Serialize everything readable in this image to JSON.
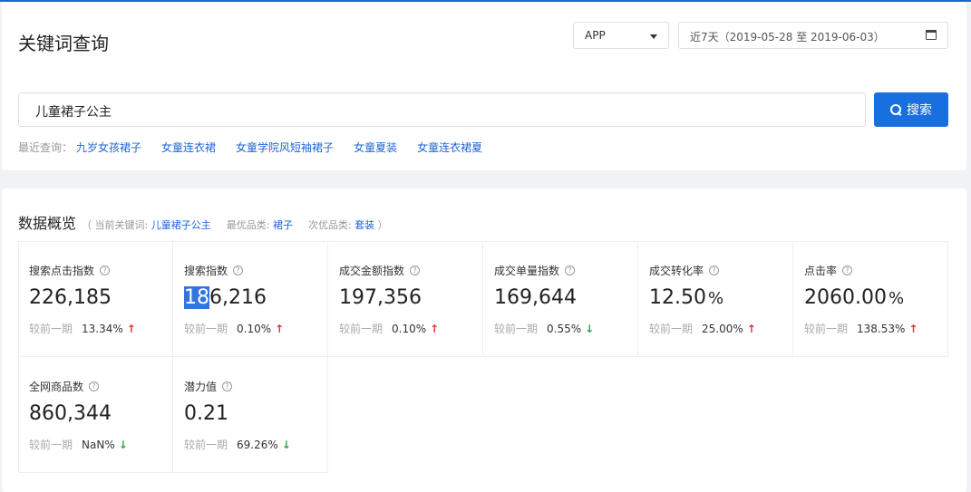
{
  "header": {
    "title": "关键词查询",
    "platform_select": "APP",
    "date_range": "近7天（2019-05-28 至 2019-06-03）"
  },
  "search": {
    "value": "儿童裙子公主",
    "button_label": "搜索",
    "recent_label": "最近查询：",
    "recent": [
      "九岁女孩裙子",
      "女童连衣裙",
      "女童学院风短袖裙子",
      "女童夏装",
      "女童连衣裙夏"
    ]
  },
  "overview": {
    "title": "数据概览",
    "paren_open": "（",
    "current_keyword_label": "当前关键词:",
    "current_keyword": "儿童裙子公主",
    "best_category_label": "最优品类:",
    "best_category": "裙子",
    "second_category_label": "次优品类:",
    "second_category": "套装",
    "paren_close": "）"
  },
  "help_glyph": "?",
  "compare_label": "较前一期",
  "metrics": [
    {
      "label": "搜索点击指数",
      "value": "226,185",
      "unit": "",
      "change": "13.34%",
      "trend": "up"
    },
    {
      "label": "搜索指数",
      "value_hl": "18",
      "value": "6,216",
      "unit": "",
      "change": "0.10%",
      "trend": "up"
    },
    {
      "label": "成交金额指数",
      "value": "197,356",
      "unit": "",
      "change": "0.10%",
      "trend": "up"
    },
    {
      "label": "成交单量指数",
      "value": "169,644",
      "unit": "",
      "change": "0.55%",
      "trend": "down"
    },
    {
      "label": "成交转化率",
      "value": "12.50",
      "unit": "%",
      "change": "25.00%",
      "trend": "up"
    },
    {
      "label": "点击率",
      "value": "2060.00",
      "unit": "%",
      "change": "138.53%",
      "trend": "up"
    },
    {
      "label": "全网商品数",
      "value": "860,344",
      "unit": "",
      "change": "NaN%",
      "trend": "down"
    },
    {
      "label": "潜力值",
      "value": "0.21",
      "unit": "",
      "change": "69.26%",
      "trend": "down"
    }
  ],
  "arrows": {
    "up": "↑",
    "down": "↓"
  },
  "colors": {
    "primary": "#1a6fe0",
    "up": "#e0323c",
    "down": "#2ea44f"
  }
}
